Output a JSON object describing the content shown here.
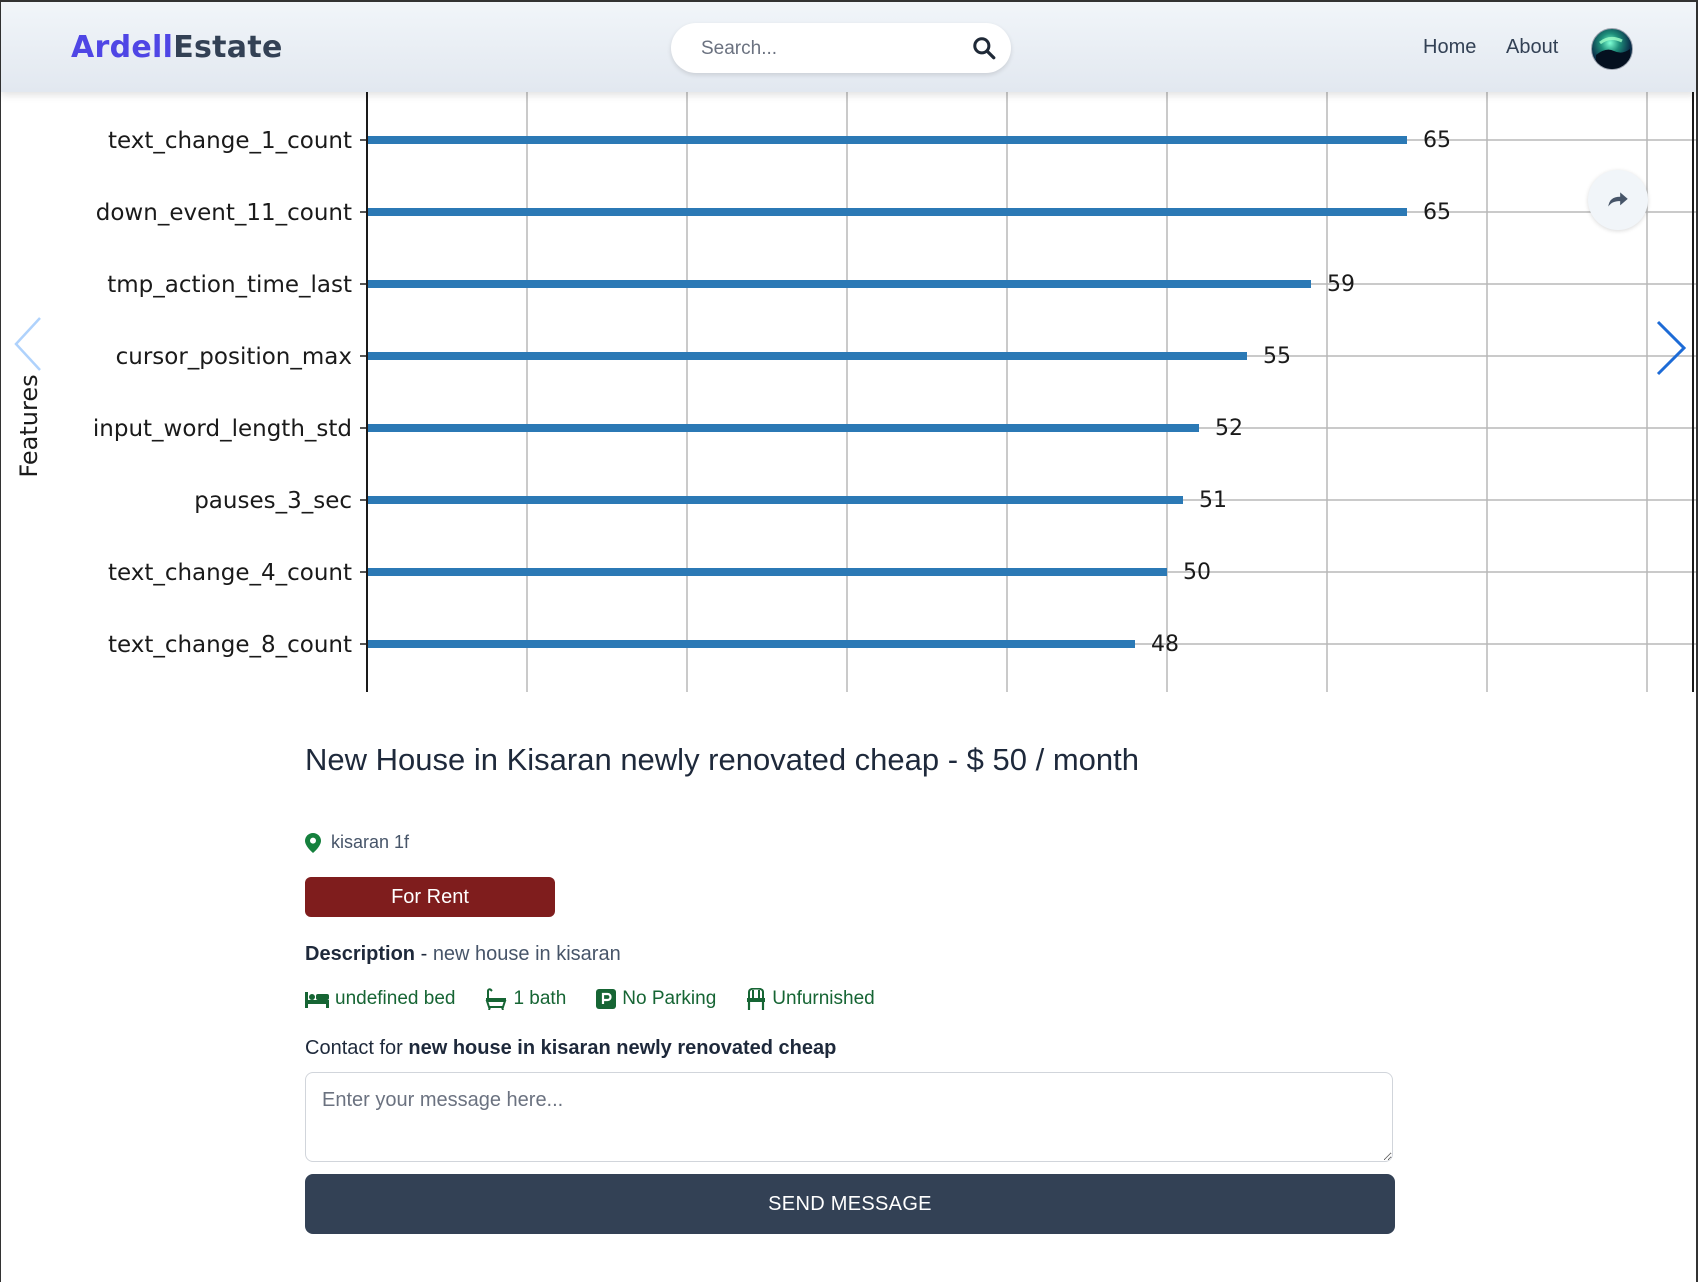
{
  "header": {
    "logo_part1": "Ardell",
    "logo_part2": "Estate",
    "search_placeholder": "Search...",
    "nav": [
      {
        "label": "Home"
      },
      {
        "label": "About"
      }
    ]
  },
  "chart_data": {
    "type": "bar",
    "orientation": "horizontal",
    "ylabel": "Features",
    "categories": [
      "text_change_1_count",
      "down_event_11_count",
      "tmp_action_time_last",
      "cursor_position_max",
      "input_word_length_std",
      "pauses_3_sec",
      "text_change_4_count",
      "text_change_8_count"
    ],
    "values": [
      65,
      65,
      59,
      55,
      52,
      51,
      50,
      48
    ],
    "xlim": [
      0,
      82
    ],
    "grid": true,
    "bar_color": "#2b79b5"
  },
  "listing": {
    "title": "New House in Kisaran newly renovated cheap - $ 50 / month",
    "location": "kisaran 1f",
    "type_badge": "For Rent",
    "description_label": "Description",
    "description_sep": " - ",
    "description_value": "new house in kisaran",
    "features": {
      "bed": "undefined bed",
      "bath": "1 bath",
      "parking": "No Parking",
      "furnished": "Unfurnished"
    },
    "contact_prefix": "Contact for ",
    "contact_name": "new house in kisaran newly renovated cheap",
    "message_placeholder": "Enter your message here...",
    "send_label": "SEND MESSAGE"
  },
  "colors": {
    "brand": "#4f46e5",
    "badge": "#7f1d1d",
    "button": "#334155",
    "feature": "#166534"
  }
}
